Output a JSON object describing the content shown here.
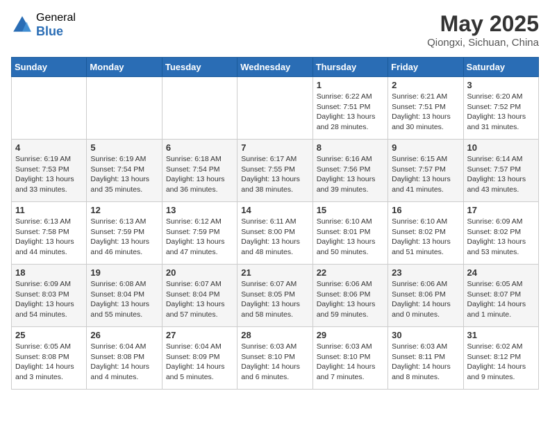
{
  "header": {
    "logo_general": "General",
    "logo_blue": "Blue",
    "title": "May 2025",
    "location": "Qiongxi, Sichuan, China"
  },
  "weekdays": [
    "Sunday",
    "Monday",
    "Tuesday",
    "Wednesday",
    "Thursday",
    "Friday",
    "Saturday"
  ],
  "weeks": [
    [
      {
        "day": "",
        "detail": ""
      },
      {
        "day": "",
        "detail": ""
      },
      {
        "day": "",
        "detail": ""
      },
      {
        "day": "",
        "detail": ""
      },
      {
        "day": "1",
        "detail": "Sunrise: 6:22 AM\nSunset: 7:51 PM\nDaylight: 13 hours\nand 28 minutes."
      },
      {
        "day": "2",
        "detail": "Sunrise: 6:21 AM\nSunset: 7:51 PM\nDaylight: 13 hours\nand 30 minutes."
      },
      {
        "day": "3",
        "detail": "Sunrise: 6:20 AM\nSunset: 7:52 PM\nDaylight: 13 hours\nand 31 minutes."
      }
    ],
    [
      {
        "day": "4",
        "detail": "Sunrise: 6:19 AM\nSunset: 7:53 PM\nDaylight: 13 hours\nand 33 minutes."
      },
      {
        "day": "5",
        "detail": "Sunrise: 6:19 AM\nSunset: 7:54 PM\nDaylight: 13 hours\nand 35 minutes."
      },
      {
        "day": "6",
        "detail": "Sunrise: 6:18 AM\nSunset: 7:54 PM\nDaylight: 13 hours\nand 36 minutes."
      },
      {
        "day": "7",
        "detail": "Sunrise: 6:17 AM\nSunset: 7:55 PM\nDaylight: 13 hours\nand 38 minutes."
      },
      {
        "day": "8",
        "detail": "Sunrise: 6:16 AM\nSunset: 7:56 PM\nDaylight: 13 hours\nand 39 minutes."
      },
      {
        "day": "9",
        "detail": "Sunrise: 6:15 AM\nSunset: 7:57 PM\nDaylight: 13 hours\nand 41 minutes."
      },
      {
        "day": "10",
        "detail": "Sunrise: 6:14 AM\nSunset: 7:57 PM\nDaylight: 13 hours\nand 43 minutes."
      }
    ],
    [
      {
        "day": "11",
        "detail": "Sunrise: 6:13 AM\nSunset: 7:58 PM\nDaylight: 13 hours\nand 44 minutes."
      },
      {
        "day": "12",
        "detail": "Sunrise: 6:13 AM\nSunset: 7:59 PM\nDaylight: 13 hours\nand 46 minutes."
      },
      {
        "day": "13",
        "detail": "Sunrise: 6:12 AM\nSunset: 7:59 PM\nDaylight: 13 hours\nand 47 minutes."
      },
      {
        "day": "14",
        "detail": "Sunrise: 6:11 AM\nSunset: 8:00 PM\nDaylight: 13 hours\nand 48 minutes."
      },
      {
        "day": "15",
        "detail": "Sunrise: 6:10 AM\nSunset: 8:01 PM\nDaylight: 13 hours\nand 50 minutes."
      },
      {
        "day": "16",
        "detail": "Sunrise: 6:10 AM\nSunset: 8:02 PM\nDaylight: 13 hours\nand 51 minutes."
      },
      {
        "day": "17",
        "detail": "Sunrise: 6:09 AM\nSunset: 8:02 PM\nDaylight: 13 hours\nand 53 minutes."
      }
    ],
    [
      {
        "day": "18",
        "detail": "Sunrise: 6:09 AM\nSunset: 8:03 PM\nDaylight: 13 hours\nand 54 minutes."
      },
      {
        "day": "19",
        "detail": "Sunrise: 6:08 AM\nSunset: 8:04 PM\nDaylight: 13 hours\nand 55 minutes."
      },
      {
        "day": "20",
        "detail": "Sunrise: 6:07 AM\nSunset: 8:04 PM\nDaylight: 13 hours\nand 57 minutes."
      },
      {
        "day": "21",
        "detail": "Sunrise: 6:07 AM\nSunset: 8:05 PM\nDaylight: 13 hours\nand 58 minutes."
      },
      {
        "day": "22",
        "detail": "Sunrise: 6:06 AM\nSunset: 8:06 PM\nDaylight: 13 hours\nand 59 minutes."
      },
      {
        "day": "23",
        "detail": "Sunrise: 6:06 AM\nSunset: 8:06 PM\nDaylight: 14 hours\nand 0 minutes."
      },
      {
        "day": "24",
        "detail": "Sunrise: 6:05 AM\nSunset: 8:07 PM\nDaylight: 14 hours\nand 1 minute."
      }
    ],
    [
      {
        "day": "25",
        "detail": "Sunrise: 6:05 AM\nSunset: 8:08 PM\nDaylight: 14 hours\nand 3 minutes."
      },
      {
        "day": "26",
        "detail": "Sunrise: 6:04 AM\nSunset: 8:08 PM\nDaylight: 14 hours\nand 4 minutes."
      },
      {
        "day": "27",
        "detail": "Sunrise: 6:04 AM\nSunset: 8:09 PM\nDaylight: 14 hours\nand 5 minutes."
      },
      {
        "day": "28",
        "detail": "Sunrise: 6:03 AM\nSunset: 8:10 PM\nDaylight: 14 hours\nand 6 minutes."
      },
      {
        "day": "29",
        "detail": "Sunrise: 6:03 AM\nSunset: 8:10 PM\nDaylight: 14 hours\nand 7 minutes."
      },
      {
        "day": "30",
        "detail": "Sunrise: 6:03 AM\nSunset: 8:11 PM\nDaylight: 14 hours\nand 8 minutes."
      },
      {
        "day": "31",
        "detail": "Sunrise: 6:02 AM\nSunset: 8:12 PM\nDaylight: 14 hours\nand 9 minutes."
      }
    ]
  ]
}
